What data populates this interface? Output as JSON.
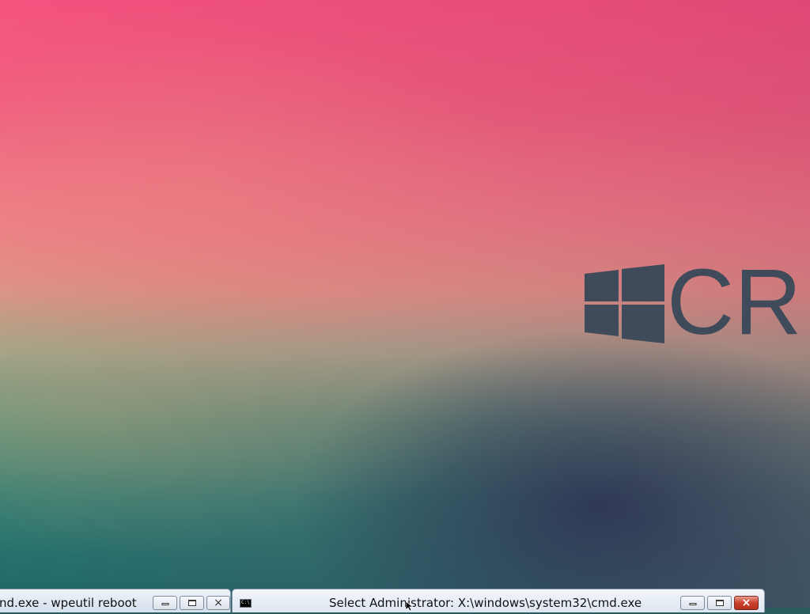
{
  "desktop": {
    "logo": {
      "icon": "windows-logo-icon",
      "text": "CR",
      "color": "#3f4a5a"
    }
  },
  "windows": [
    {
      "title": "nd.exe - wpeutil  reboot",
      "controls": {
        "minimize": "minimize-icon",
        "maximize": "maximize-icon",
        "close": "×"
      }
    },
    {
      "icon": "cmd-icon",
      "icon_text": "C:\\",
      "title": "Select Administrator: X:\\windows\\system32\\cmd.exe",
      "controls": {
        "minimize": "minimize-icon",
        "maximize": "maximize-icon",
        "close": "×"
      }
    }
  ],
  "colors": {
    "close_button": "#c9412d",
    "titlebar": "#dce6f1"
  }
}
